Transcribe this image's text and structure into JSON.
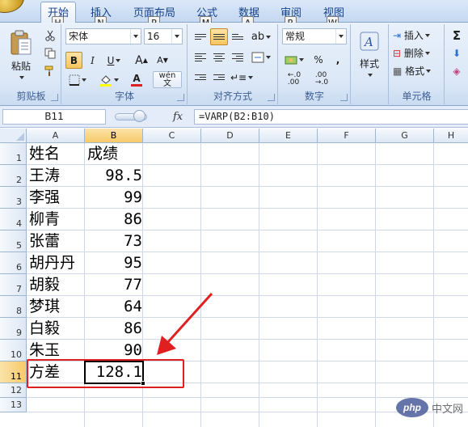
{
  "ribbon": {
    "tabs": [
      {
        "label": "开始",
        "key": "H",
        "active": true
      },
      {
        "label": "插入",
        "key": "N"
      },
      {
        "label": "页面布局",
        "key": "P"
      },
      {
        "label": "公式",
        "key": "M"
      },
      {
        "label": "数据",
        "key": "A"
      },
      {
        "label": "审阅",
        "key": "R"
      },
      {
        "label": "视图",
        "key": "W"
      }
    ],
    "clipboard": {
      "paste_label": "粘贴",
      "group_label": "剪贴板"
    },
    "font": {
      "name": "宋体",
      "size": "16",
      "bold": "B",
      "italic": "I",
      "underline": "U",
      "grow": "A",
      "shrink": "A",
      "font_color": "A",
      "phonetic": "wén",
      "group_label": "字体"
    },
    "alignment": {
      "group_label": "对齐方式"
    },
    "number": {
      "format": "常规",
      "percent": "%",
      "comma": ",",
      "inc_decimal": ".00",
      "dec_decimal": ".0",
      "group_label": "数字"
    },
    "styles": {
      "label": "样式"
    },
    "cells": {
      "insert": "插入",
      "delete": "删除",
      "format": "格式",
      "group_label": "单元格"
    },
    "editing": {
      "sigma": "Σ"
    }
  },
  "formula_bar": {
    "name_box": "B11",
    "fx": "fx",
    "formula": "=VARP(B2:B10)"
  },
  "grid": {
    "columns": [
      "A",
      "B",
      "C",
      "D",
      "E",
      "F",
      "G",
      "H"
    ],
    "selected_column": "B",
    "rows": [
      "1",
      "2",
      "3",
      "4",
      "5",
      "6",
      "7",
      "8",
      "9",
      "10",
      "11",
      "12",
      "13"
    ],
    "selected_row": "11",
    "cells": [
      {
        "a": "姓名",
        "b": "成绩"
      },
      {
        "a": "王涛",
        "b": "98.5"
      },
      {
        "a": "李强",
        "b": "99"
      },
      {
        "a": "柳青",
        "b": "86"
      },
      {
        "a": "张蕾",
        "b": "73"
      },
      {
        "a": "胡丹丹",
        "b": "95"
      },
      {
        "a": "胡毅",
        "b": "77"
      },
      {
        "a": "梦琪",
        "b": "64"
      },
      {
        "a": "白毅",
        "b": "86"
      },
      {
        "a": "朱玉",
        "b": "90"
      },
      {
        "a": "方差",
        "b": "128.1"
      }
    ]
  },
  "annotation": {
    "color": "#e02020"
  },
  "watermark": {
    "logo": "php",
    "text": "中文网"
  }
}
